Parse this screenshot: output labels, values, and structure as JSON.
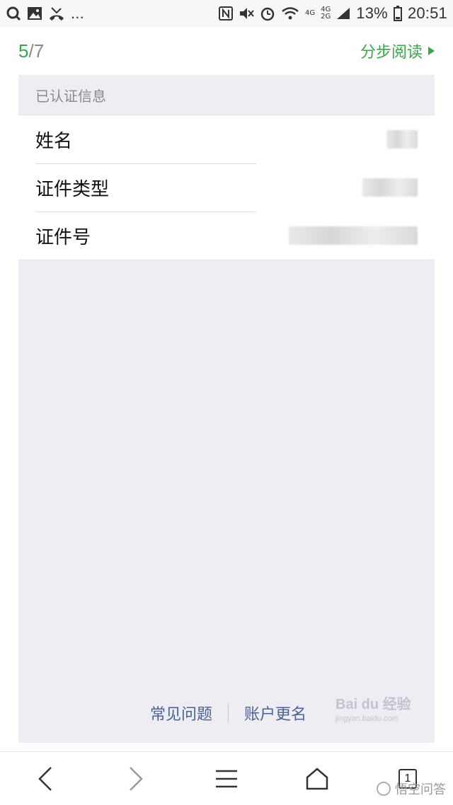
{
  "statusbar": {
    "signal_4g": "4G",
    "signal_4g_top": "4G",
    "signal_2g": "2G",
    "battery_percent": "13%",
    "time": "20:51",
    "more": "..."
  },
  "nav": {
    "pager_current": "5",
    "pager_total": "/7",
    "step_read_label": "分步阅读"
  },
  "section": {
    "header": "已认证信息",
    "rows": [
      {
        "label": "姓名"
      },
      {
        "label": "证件类型"
      },
      {
        "label": "证件号"
      }
    ]
  },
  "footer": {
    "faq": "常见问题",
    "rename": "账户更名"
  },
  "watermark": {
    "brand": "Bai du 经验",
    "sub": "jingyan.baidu.com"
  },
  "toolbar": {
    "tabs_count": "1",
    "wukong_label": "悟空问答"
  },
  "colors": {
    "accent_green": "#3aa64a",
    "link_blue": "#4a6294",
    "panel_bg": "#efedf4"
  }
}
